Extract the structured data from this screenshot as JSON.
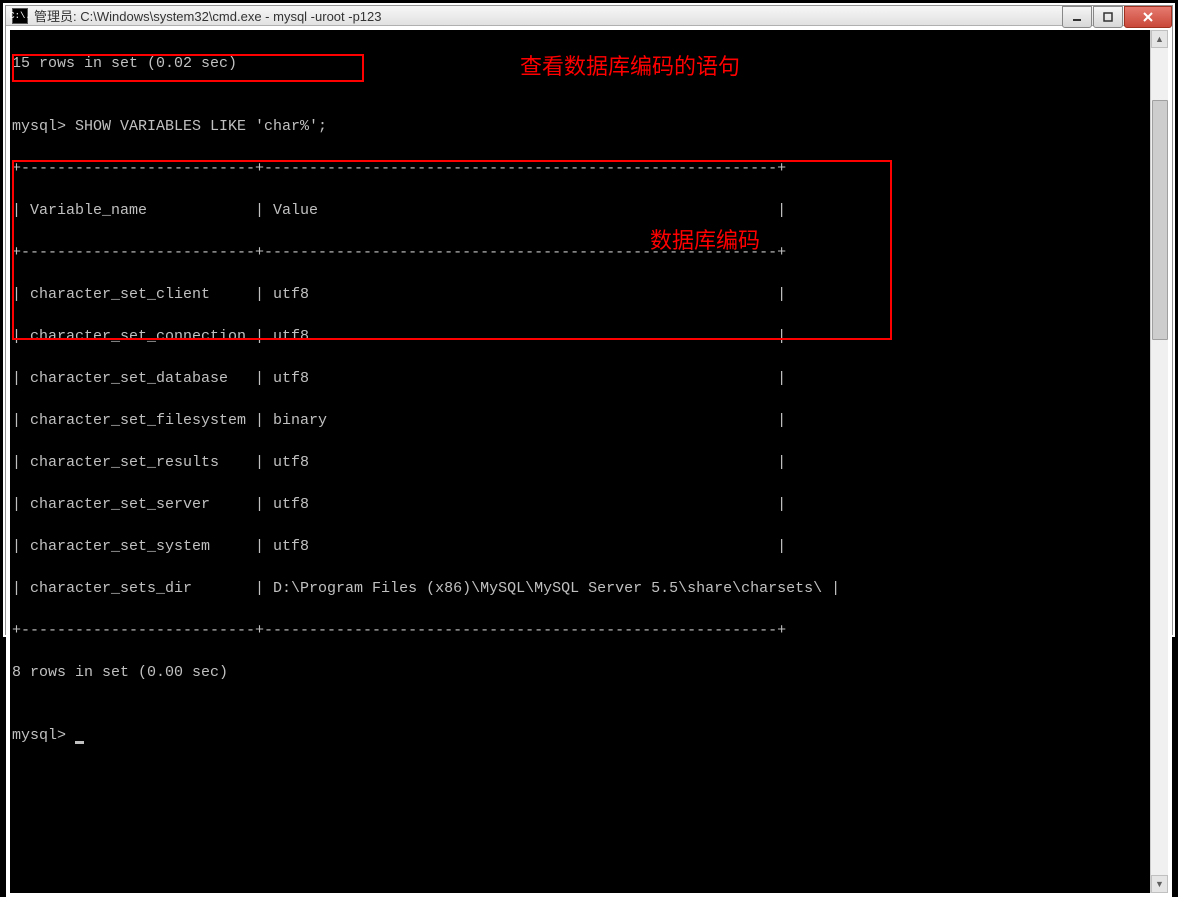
{
  "window": {
    "title_prefix": "管理员: ",
    "title_path": "C:\\Windows\\system32\\cmd.exe - mysql  -uroot -p123",
    "icon_text": "C:\\."
  },
  "terminal": {
    "prev_result": "15 rows in set (0.02 sec)",
    "blank1": "",
    "prompt_line": "mysql> SHOW VARIABLES LIKE 'char%';",
    "sep_top": "+--------------------------+---------------------------------------------------------+",
    "header_row": "| Variable_name            | Value                                                   |",
    "sep_mid": "+--------------------------+---------------------------------------------------------+",
    "rows": [
      "| character_set_client     | utf8                                                    |",
      "| character_set_connection | utf8                                                    |",
      "| character_set_database   | utf8                                                    |",
      "| character_set_filesystem | binary                                                  |",
      "| character_set_results    | utf8                                                    |",
      "| character_set_server     | utf8                                                    |",
      "| character_set_system     | utf8                                                    |",
      "| character_sets_dir       | D:\\Program Files (x86)\\MySQL\\MySQL Server 5.5\\share\\charsets\\ |"
    ],
    "sep_bot": "+--------------------------+---------------------------------------------------------+",
    "result_summary": "8 rows in set (0.00 sec)",
    "blank2": "",
    "prompt2": "mysql> "
  },
  "annotations": {
    "query_label": "查看数据库编码的语句",
    "result_label": "数据库编码"
  }
}
